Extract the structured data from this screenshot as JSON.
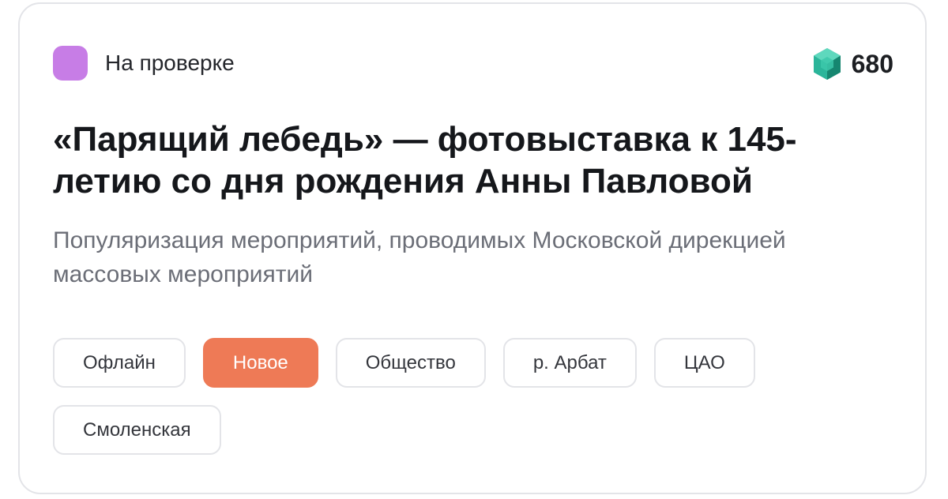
{
  "status": {
    "label": "На проверке",
    "color": "#c77de6"
  },
  "points": {
    "value": "680",
    "icon": "gem-icon",
    "icon_color": "#2bb59a"
  },
  "title": "«Парящий лебедь» — фотовыставка к 145-летию со дня рождения Анны Павловой",
  "subtitle": "Популяризация мероприятий, проводимых Московской дирекцией массовых мероприятий",
  "tags": [
    {
      "label": "Офлайн",
      "active": false
    },
    {
      "label": "Новое",
      "active": true
    },
    {
      "label": "Общество",
      "active": false
    },
    {
      "label": "р. Арбат",
      "active": false
    },
    {
      "label": "ЦАО",
      "active": false
    },
    {
      "label": "Смоленская",
      "active": false
    }
  ],
  "colors": {
    "accent": "#ee7a56",
    "border": "#e3e4e8",
    "title": "#15171b",
    "subtitle": "#6b6e77"
  }
}
